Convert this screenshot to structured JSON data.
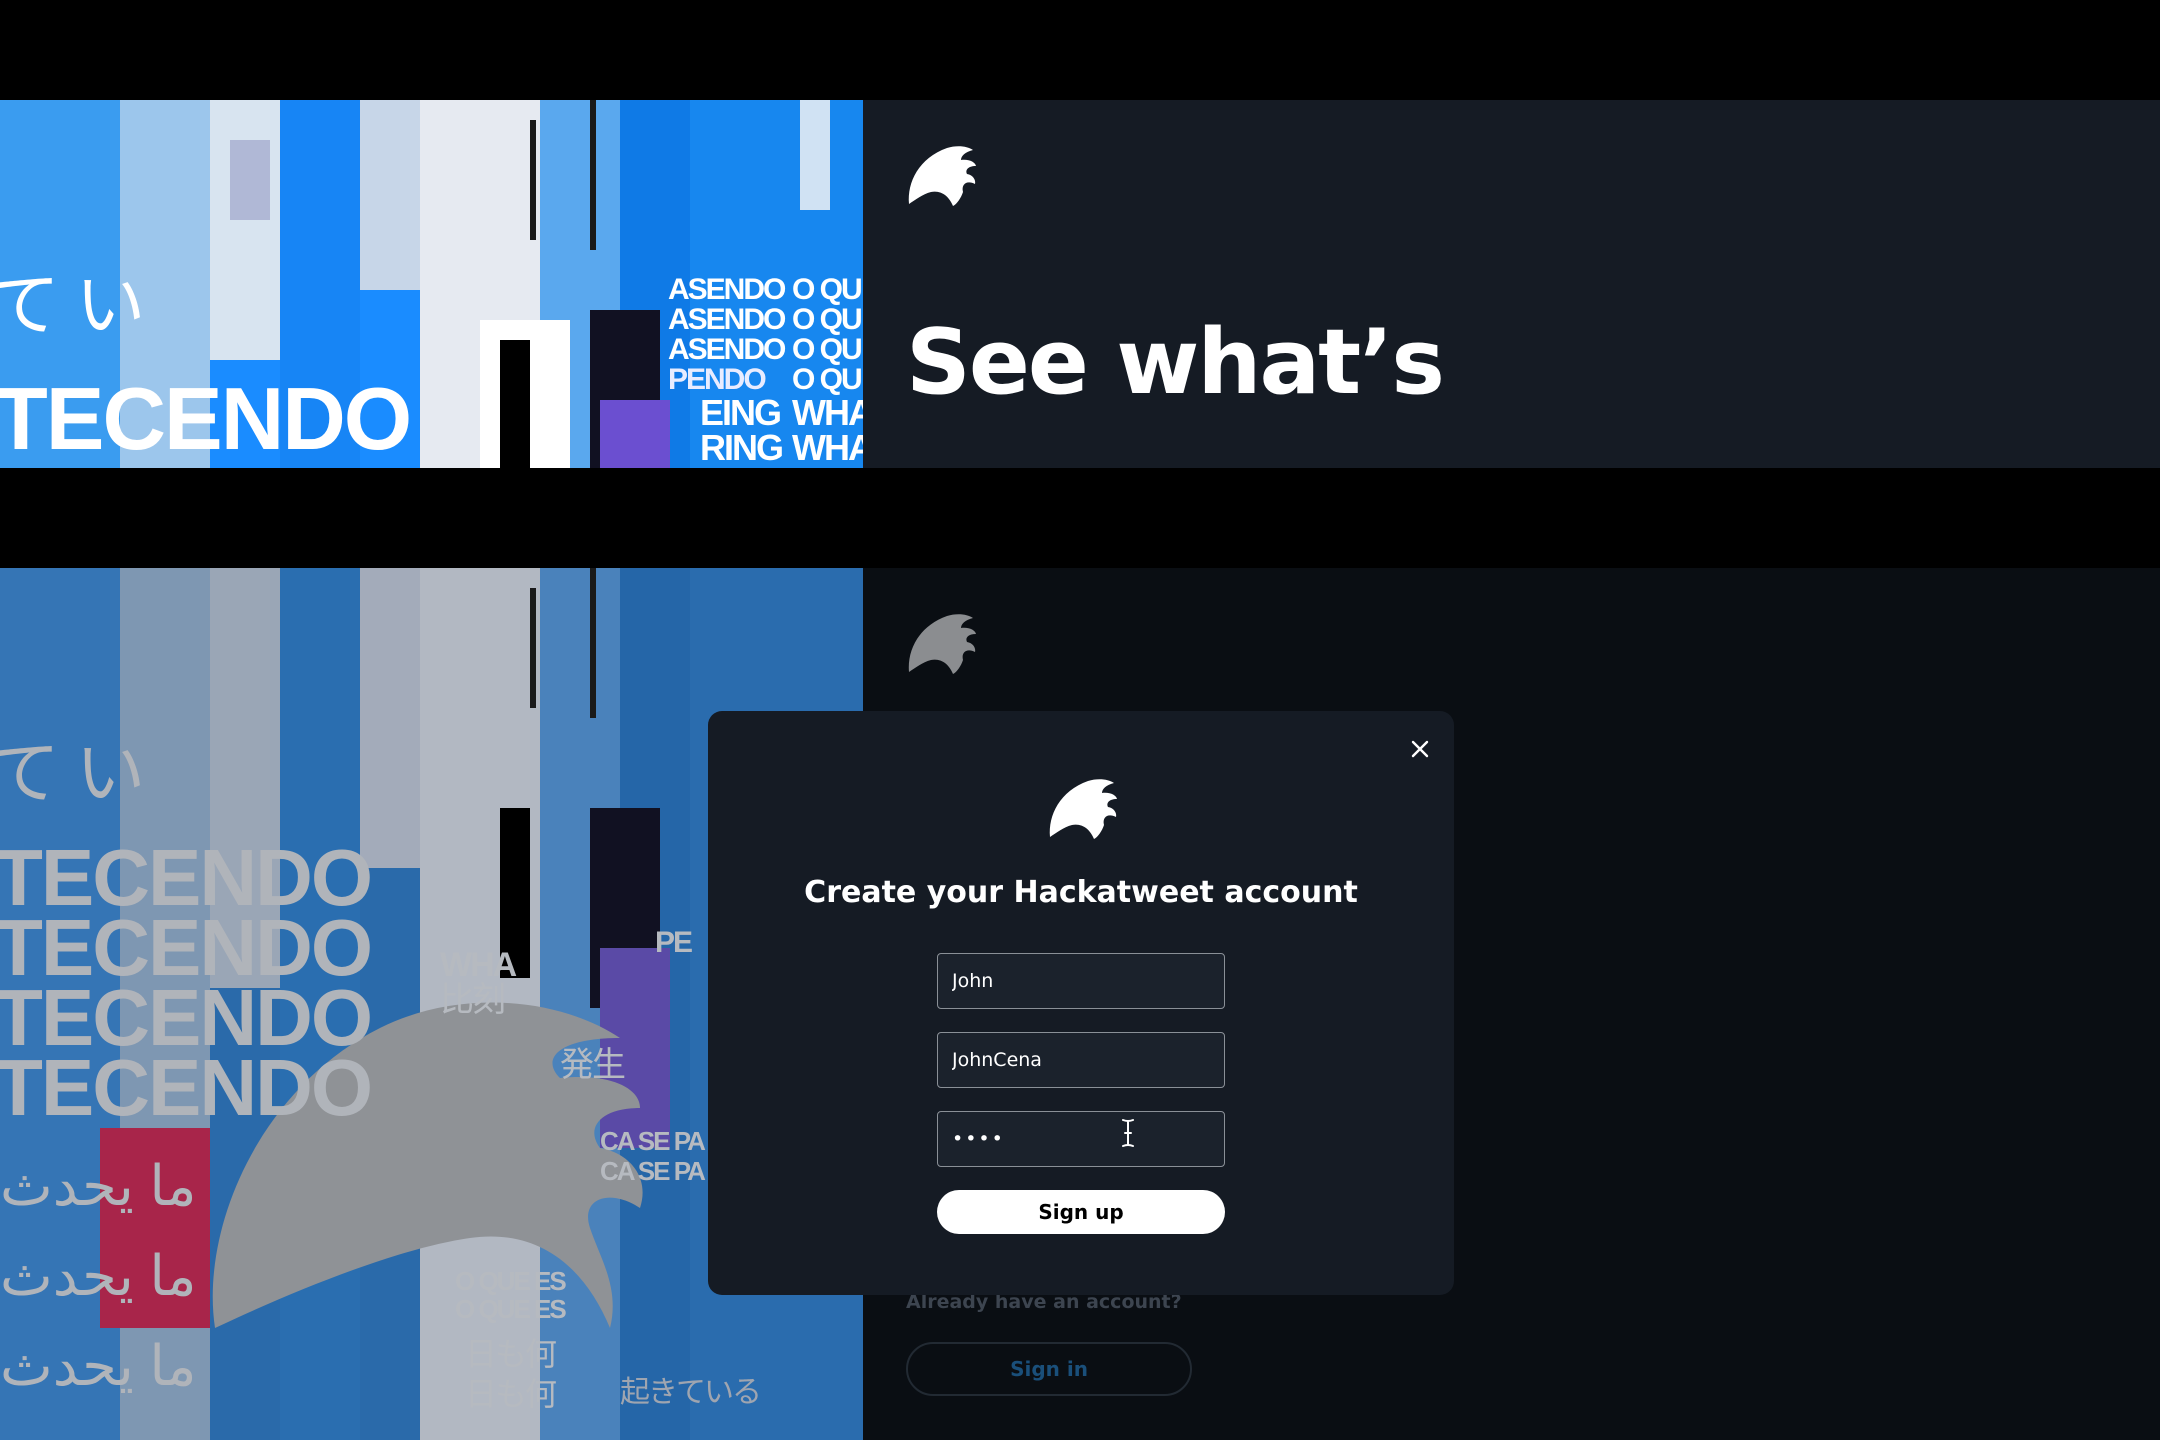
{
  "hero": {
    "heading": "See what’s"
  },
  "background_art": {
    "texts_top": [
      "TECENDO",
      "て い",
      "ASENDO",
      "ASENDO",
      "ASENDO",
      "PENDO",
      "EING",
      "RING",
      "O QU",
      "O QU",
      "O QU",
      "O QU",
      "WHA",
      "WHA"
    ],
    "texts_bottom": [
      "TECENDO",
      "TECENDO",
      "TECENDO",
      "TECENDO",
      "て い",
      "WHA",
      "比刻",
      "CA SE PA",
      "CA SE PA",
      "O QUE ES",
      "O QUE ES",
      "日も何",
      "日も何",
      "起きている",
      "ما يحدث",
      "ما يحدث",
      "ما يحدث",
      "発生",
      "PE"
    ]
  },
  "secondary": {
    "already_text": "Already have an account?",
    "signin_label": "Sign in"
  },
  "modal": {
    "title": "Create your Hackatweet account",
    "name_value": "John",
    "username_value": "JohnCena",
    "password_value": "••••",
    "signup_label": "Sign up"
  },
  "icons": {
    "logo": "feather-bird-logo-icon",
    "close": "close-icon",
    "cursor": "text-cursor-icon"
  },
  "colors": {
    "page_bg": "#000000",
    "panel_dark": "#151b24",
    "art_blue": "#1a8cff",
    "signin_text": "#1a4f7a"
  }
}
